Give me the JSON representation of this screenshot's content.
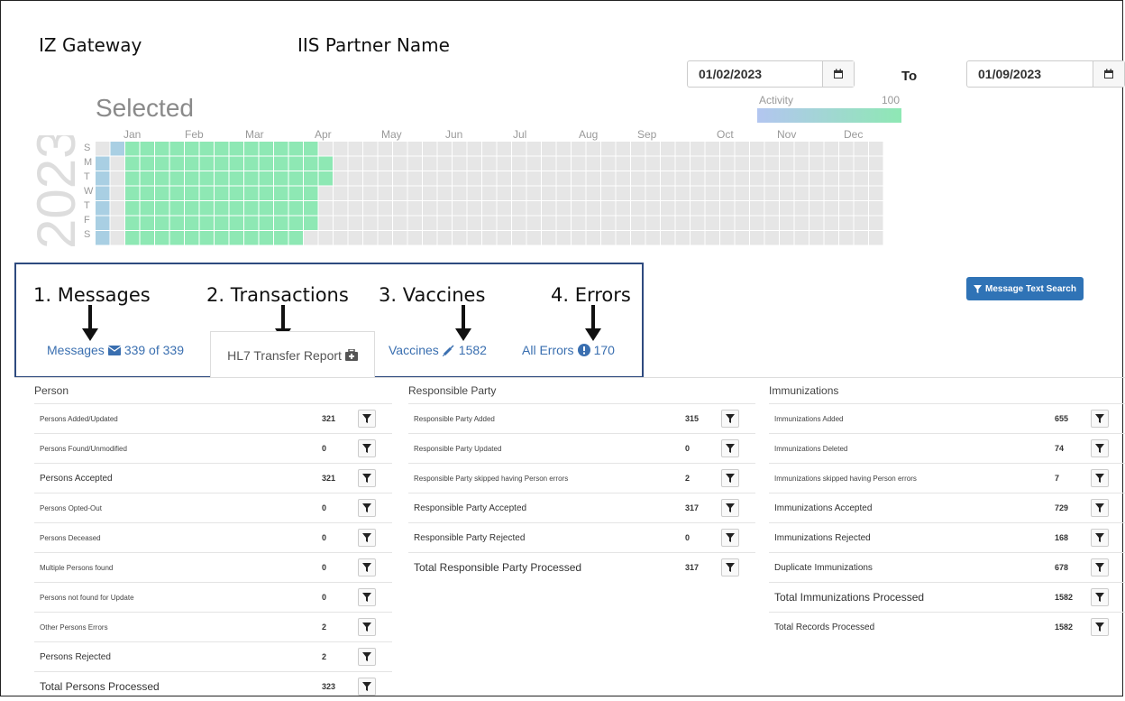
{
  "header": {
    "org": "IZ Gateway",
    "partner": "IIS Partner Name"
  },
  "date_range": {
    "from": "01/02/2023",
    "to_label": "To",
    "to": "01/09/2023"
  },
  "calendar": {
    "title": "Selected",
    "year": "2023",
    "activity_label": "Activity",
    "activity_max": "100",
    "months": [
      "Jan",
      "Feb",
      "Mar",
      "Apr",
      "May",
      "Jun",
      "Jul",
      "Aug",
      "Sep",
      "Oct",
      "Nov",
      "Dec"
    ],
    "days": [
      "S",
      "M",
      "T",
      "W",
      "T",
      "F",
      "S"
    ],
    "colors": {
      "active": "#8ee8b4",
      "selected": "#a9cfe3",
      "empty": "#e6e6e6",
      "accent": "#2f73b6"
    }
  },
  "annotations": [
    "1. Messages",
    "2. Transactions",
    "3. Vaccines",
    "4. Errors"
  ],
  "tabs": {
    "messages": {
      "label": "Messages",
      "count": "339 of 339"
    },
    "transfer": {
      "label": "HL7 Transfer Report"
    },
    "vaccines": {
      "label": "Vaccines",
      "count": "1582"
    },
    "errors": {
      "label": "All Errors",
      "count": "170"
    }
  },
  "search_button": "Message Text Search",
  "person": {
    "title": "Person",
    "rows": [
      {
        "label": "Persons Added/Updated",
        "value": "321"
      },
      {
        "label": "Persons Found/Unmodified",
        "value": "0"
      },
      {
        "label": "Persons Accepted",
        "value": "321"
      },
      {
        "label": "Persons Opted-Out",
        "value": "0"
      },
      {
        "label": "Persons Deceased",
        "value": "0"
      },
      {
        "label": "Multiple Persons found",
        "value": "0"
      },
      {
        "label": "Persons not found for Update",
        "value": "0"
      },
      {
        "label": "Other Persons Errors",
        "value": "2"
      },
      {
        "label": "Persons Rejected",
        "value": "2"
      },
      {
        "label": "Total Persons Processed",
        "value": "323"
      }
    ]
  },
  "responsible": {
    "title": "Responsible Party",
    "rows": [
      {
        "label": "Responsible Party Added",
        "value": "315"
      },
      {
        "label": "Responsible Party Updated",
        "value": "0"
      },
      {
        "label": "Responsible Party skipped having Person errors",
        "value": "2"
      },
      {
        "label": "Responsible Party Accepted",
        "value": "317"
      },
      {
        "label": "Responsible Party Rejected",
        "value": "0"
      },
      {
        "label": "Total Responsible Party Processed",
        "value": "317"
      }
    ]
  },
  "immunizations": {
    "title": "Immunizations",
    "rows": [
      {
        "label": "Immunizations Added",
        "value": "655"
      },
      {
        "label": "Immunizations Deleted",
        "value": "74"
      },
      {
        "label": "Immunizations skipped having Person errors",
        "value": "7"
      },
      {
        "label": "Immunizations Accepted",
        "value": "729"
      },
      {
        "label": "Immunizations Rejected",
        "value": "168"
      },
      {
        "label": "Duplicate Immunizations",
        "value": "678"
      },
      {
        "label": "Total Immunizations Processed",
        "value": "1582"
      },
      {
        "label": "Total Records Processed",
        "value": "1582"
      }
    ]
  }
}
